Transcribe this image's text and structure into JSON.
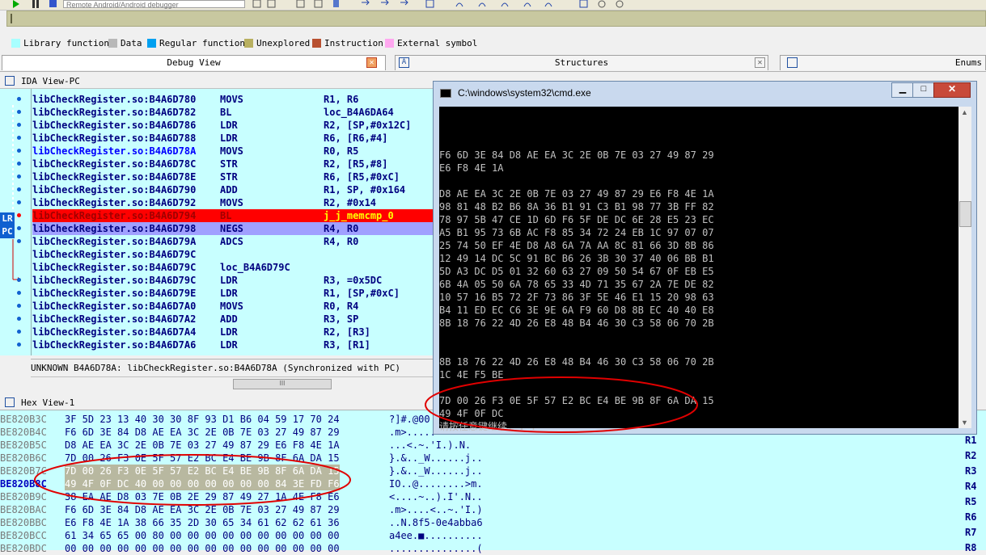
{
  "toolbar": {
    "debugger_value": "Remote Android/Android debugger"
  },
  "legend": [
    {
      "label": "Library function",
      "color": "#a8ffff"
    },
    {
      "label": "Data",
      "color": "#b8b8b8"
    },
    {
      "label": "Regular function",
      "color": "#00a0f0"
    },
    {
      "label": "Unexplored",
      "color": "#b8b060"
    },
    {
      "label": "Instruction",
      "color": "#b85030"
    },
    {
      "label": "External symbol",
      "color": "#ffa8f0"
    }
  ],
  "tabs": {
    "debug_view": "Debug View",
    "structures": "Structures",
    "enums": "Enums"
  },
  "ida_view": {
    "title": "IDA View-PC",
    "lr_label": "LR",
    "pc_label": "PC",
    "rows": [
      {
        "addr": "libCheckRegister.so:B4A6D780",
        "op": "MOVS",
        "arg": "R1, R6",
        "bp": true,
        "style": "normal"
      },
      {
        "addr": "libCheckRegister.so:B4A6D782",
        "op": "BL",
        "arg": "loc_B4A6DA64",
        "bp": true,
        "style": "normal"
      },
      {
        "addr": "libCheckRegister.so:B4A6D786",
        "op": "LDR",
        "arg": "R2, [SP,#0x12C]",
        "bp": true,
        "style": "normal"
      },
      {
        "addr": "libCheckRegister.so:B4A6D788",
        "op": "LDR",
        "arg": "R6, [R6,#4]",
        "bp": true,
        "style": "normal"
      },
      {
        "addr": "libCheckRegister.so:B4A6D78A",
        "op": "MOVS",
        "arg": "R0, R5",
        "bp": true,
        "style": "label"
      },
      {
        "addr": "libCheckRegister.so:B4A6D78C",
        "op": "STR",
        "arg": "R2, [R5,#8]",
        "bp": true,
        "style": "normal"
      },
      {
        "addr": "libCheckRegister.so:B4A6D78E",
        "op": "STR",
        "arg": "R6, [R5,#0xC]",
        "bp": true,
        "style": "normal"
      },
      {
        "addr": "libCheckRegister.so:B4A6D790",
        "op": "ADD",
        "arg": "R1, SP, #0x164",
        "bp": true,
        "style": "normal"
      },
      {
        "addr": "libCheckRegister.so:B4A6D792",
        "op": "MOVS",
        "arg": "R2, #0x14",
        "bp": true,
        "style": "normal"
      },
      {
        "addr": "libCheckRegister.so:B4A6D794",
        "op": "BL",
        "arg": "j_j_memcmp_0",
        "bp": true,
        "style": "bp"
      },
      {
        "addr": "libCheckRegister.so:B4A6D798",
        "op": "NEGS",
        "arg": "R4, R0",
        "bp": true,
        "style": "pc"
      },
      {
        "addr": "libCheckRegister.so:B4A6D79A",
        "op": "ADCS",
        "arg": "R4, R0",
        "bp": true,
        "style": "normal"
      },
      {
        "addr": "libCheckRegister.so:B4A6D79C",
        "op": "",
        "arg": "",
        "bp": false,
        "style": "normal"
      },
      {
        "addr": "libCheckRegister.so:B4A6D79C",
        "op": "loc_B4A6D79C",
        "arg": "",
        "bp": false,
        "style": "loc"
      },
      {
        "addr": "libCheckRegister.so:B4A6D79C",
        "op": "LDR",
        "arg": "R3, =0x5DC",
        "bp": true,
        "style": "normal"
      },
      {
        "addr": "libCheckRegister.so:B4A6D79E",
        "op": "LDR",
        "arg": "R1, [SP,#0xC]",
        "bp": true,
        "style": "normal"
      },
      {
        "addr": "libCheckRegister.so:B4A6D7A0",
        "op": "MOVS",
        "arg": "R0, R4",
        "bp": true,
        "style": "normal"
      },
      {
        "addr": "libCheckRegister.so:B4A6D7A2",
        "op": "ADD",
        "arg": "R3, SP",
        "bp": true,
        "style": "normal"
      },
      {
        "addr": "libCheckRegister.so:B4A6D7A4",
        "op": "LDR",
        "arg": "R2, [R3]",
        "bp": true,
        "style": "normal"
      },
      {
        "addr": "libCheckRegister.so:B4A6D7A6",
        "op": "LDR",
        "arg": "R3, [R1]",
        "bp": true,
        "style": "normal"
      }
    ],
    "status": "UNKNOWN B4A6D78A: libCheckRegister.so:B4A6D78A (Synchronized with PC)",
    "scroll_glyph": "III"
  },
  "hex_view": {
    "title": "Hex View-1",
    "rows": [
      {
        "addr": "BE820B3C",
        "bytes": "3F 5D 23 13 40 30 30 8F  93 D1 B6 04 59 17 70 24",
        "ascii": "?]#.@00",
        "hl": false
      },
      {
        "addr": "BE820B4C",
        "bytes": "F6 6D 3E 84 D8 AE EA 3C  2E 0B 7E 03 27 49 87 29",
        "ascii": ".m>.....",
        "hl": false
      },
      {
        "addr": "BE820B5C",
        "bytes": "D8 AE EA 3C 2E 0B 7E 03  27 49 87 29 E6 F8 4E 1A",
        "ascii": "...<.~.'I.).N.",
        "hl": false
      },
      {
        "addr": "BE820B6C",
        "bytes": "7D 00 26 F3 0E 5F 57 E2  BC E4 BE 9B 8F 6A DA 15",
        "ascii": "}.&.._W......j..",
        "hl": false
      },
      {
        "addr": "BE820B7C",
        "bytes": "7D 00 26 F3 0E 5F 57 E2  BC E4 BE 9B 8F 6A DA 15",
        "ascii": "}.&.._W......j..",
        "hl": true
      },
      {
        "addr": "BE820B8C",
        "bytes": "49 4F 0F DC 40 00 00 00  00 00 00 00 84 3E FD F6",
        "ascii": "IO..@........>m.",
        "hl": true
      },
      {
        "addr": "BE820B9C",
        "bytes": "38 EA AE D8 03 7E 0B 2E  29 87 49 27 1A 4E F8 E6",
        "ascii": "<....~..).I'.N..",
        "hl": false
      },
      {
        "addr": "BE820BAC",
        "bytes": "F6 6D 3E 84 D8 AE EA 3C  2E 0B 7E 03 27 49 87 29",
        "ascii": ".m>....<..~.'I.)",
        "hl": false
      },
      {
        "addr": "BE820BBC",
        "bytes": "E6 F8 4E 1A 38 66 35 2D  30 65 34 61 62 62 61 36",
        "ascii": "..N.8f5-0e4abba6",
        "hl": false
      },
      {
        "addr": "BE820BCC",
        "bytes": "61 34 65 65 00 80 00 00  00 00 00 00 00 00 00 00",
        "ascii": "a4ee.■..........",
        "hl": false
      },
      {
        "addr": "BE820BDC",
        "bytes": "00 00 00 00 00 00 00 00  00 00 00 00 00 00 00 00",
        "ascii": "...............(",
        "hl": false
      }
    ]
  },
  "cmd": {
    "title": "C:\\windows\\system32\\cmd.exe",
    "lines": [
      "",
      "",
      "",
      "F6 6D 3E 84 D8 AE EA 3C 2E 0B 7E 03 27 49 87 29",
      "E6 F8 4E 1A",
      "",
      "D8 AE EA 3C 2E 0B 7E 03 27 49 87 29 E6 F8 4E 1A",
      "98 81 48 B2 B6 8A 36 B1 91 C3 B1 98 77 3B FF 82",
      "78 97 5B 47 CE 1D 6D F6 5F DE DC 6E 28 E5 23 EC",
      "A5 B1 95 73 6B AC F8 85 34 72 24 EB 1C 97 07 07",
      "25 74 50 EF 4E D8 A8 6A 7A AA 8C 81 66 3D 8B 86",
      "12 49 14 DC 5C 91 BC B6 26 3B 30 37 40 06 BB B1",
      "5D A3 DC D5 01 32 60 63 27 09 50 54 67 0F EB E5",
      "6B 4A 05 50 6A 78 65 33 4D 71 35 67 2A 7E DE 82",
      "10 57 16 B5 72 2F 73 86 3F 5E 46 E1 15 20 98 63",
      "B4 11 ED EC C6 3E 9E 6A F9 60 D8 8B EC 40 40 E8",
      "8B 18 76 22 4D 26 E8 48 B4 46 30 C3 58 06 70 2B",
      "",
      "",
      "8B 18 76 22 4D 26 E8 48 B4 46 30 C3 58 06 70 2B",
      "1C 4E F5 BE",
      "",
      "7D 00 26 F3 0E 5F 57 E2 BC E4 BE 9B 8F 6A DA 15",
      "49 4F 0F DC",
      "请按任意键继续. . ."
    ]
  },
  "registers": [
    "R1",
    "R2",
    "R3",
    "R4",
    "R5",
    "R6",
    "R7",
    "R8"
  ]
}
